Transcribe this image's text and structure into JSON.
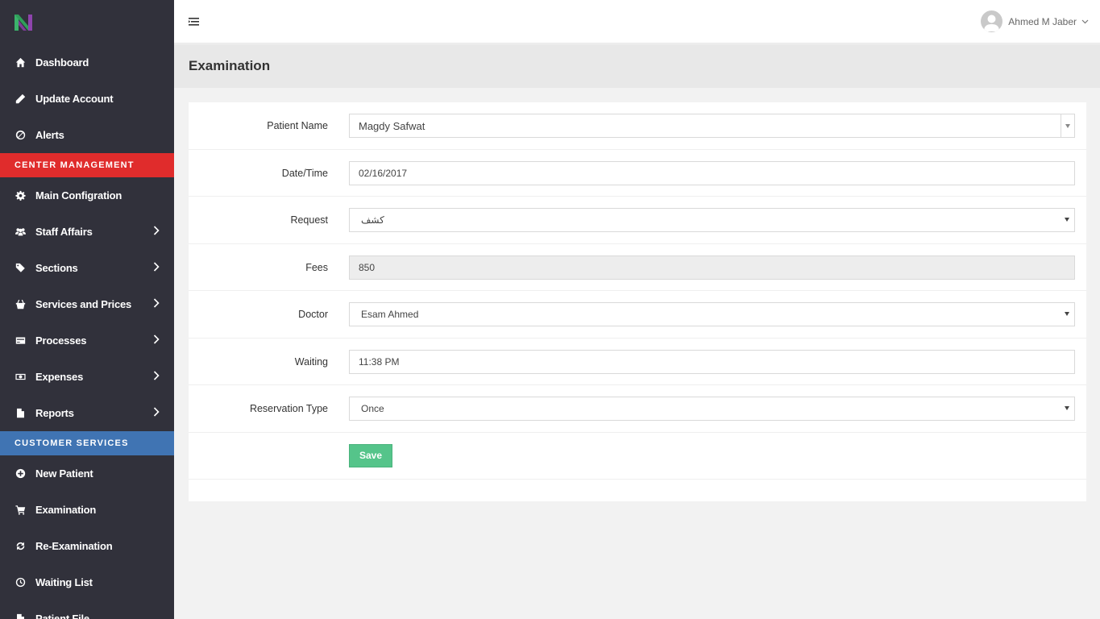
{
  "sidebar": {
    "items_top": [
      {
        "label": "Dashboard",
        "icon": "home-icon"
      },
      {
        "label": "Update Account",
        "icon": "pencil-icon"
      },
      {
        "label": "Alerts",
        "icon": "ban-icon"
      }
    ],
    "section_center": "CENTER MANAGEMENT",
    "items_center": [
      {
        "label": "Main Configration",
        "icon": "gear-icon"
      },
      {
        "label": "Staff Affairs",
        "icon": "users-icon"
      },
      {
        "label": "Sections",
        "icon": "tags-icon"
      },
      {
        "label": "Services and Prices",
        "icon": "basket-icon"
      },
      {
        "label": "Processes",
        "icon": "card-icon"
      },
      {
        "label": "Expenses",
        "icon": "money-icon"
      },
      {
        "label": "Reports",
        "icon": "file-icon"
      }
    ],
    "section_customer": "CUSTOMER SERVICES",
    "items_customer": [
      {
        "label": "New Patient",
        "icon": "plus-circle-icon"
      },
      {
        "label": "Examination",
        "icon": "cart-icon"
      },
      {
        "label": "Re-Examination",
        "icon": "refresh-icon"
      },
      {
        "label": "Waiting List",
        "icon": "clock-icon"
      },
      {
        "label": "Patient File",
        "icon": "file-icon"
      }
    ]
  },
  "topbar": {
    "user_name": "Ahmed M Jaber"
  },
  "page": {
    "title": "Examination"
  },
  "form": {
    "patient_name": {
      "label": "Patient Name",
      "value": "Magdy Safwat"
    },
    "datetime": {
      "label": "Date/Time",
      "value": "02/16/2017"
    },
    "request": {
      "label": "Request",
      "value": "كشف"
    },
    "fees": {
      "label": "Fees",
      "value": "850"
    },
    "doctor": {
      "label": "Doctor",
      "value": "Esam Ahmed"
    },
    "waiting": {
      "label": "Waiting",
      "value": "11:38 PM"
    },
    "reservation_type": {
      "label": "Reservation Type",
      "value": "Once"
    },
    "save_label": "Save"
  },
  "colors": {
    "sidebar_bg": "#31313b",
    "center_header": "#e02c2c",
    "customer_header": "#4074b3",
    "save_button": "#55c48a",
    "logo_green": "#3bb36b",
    "logo_purple": "#8e44ad"
  }
}
